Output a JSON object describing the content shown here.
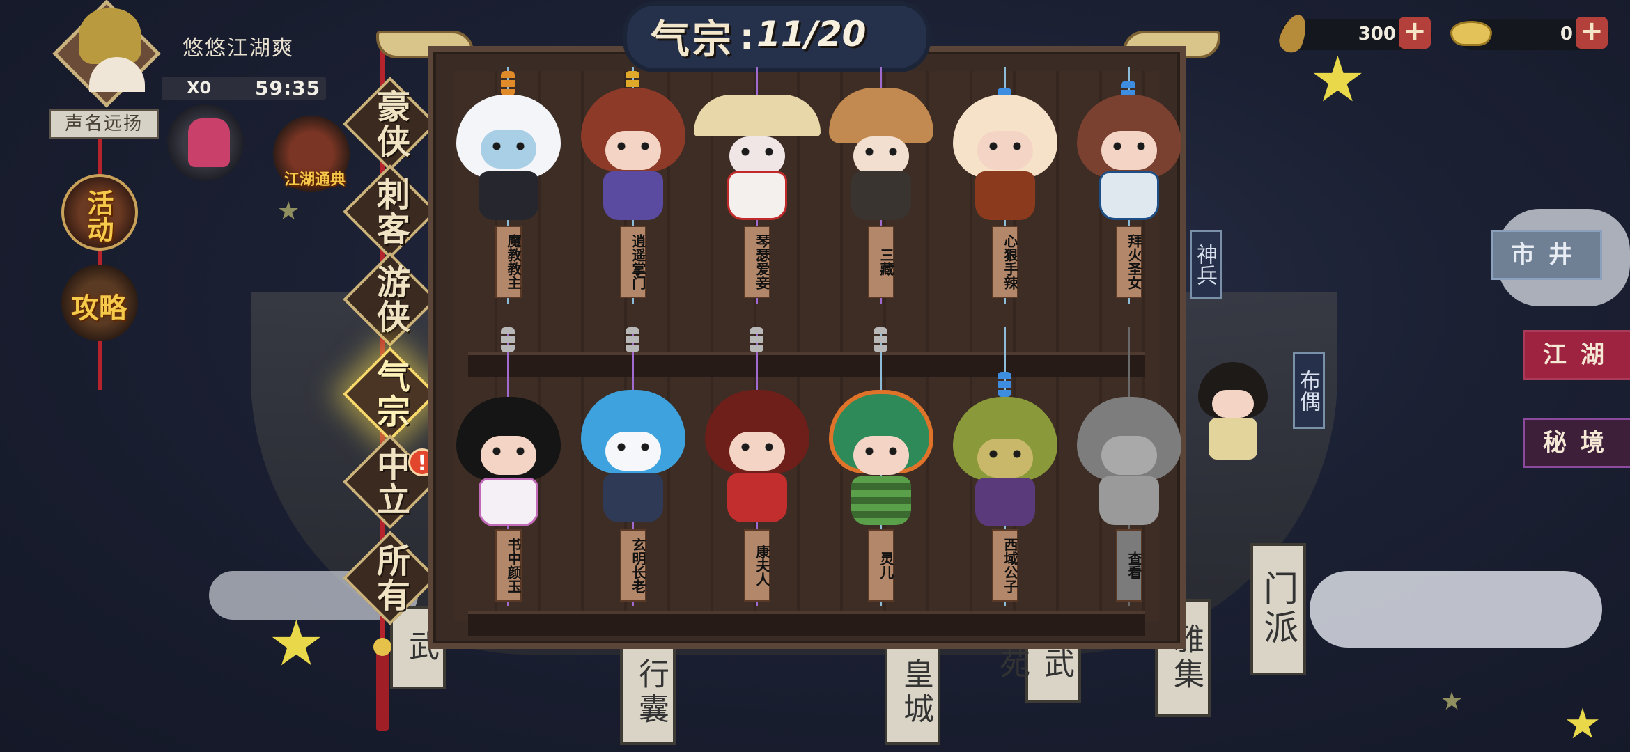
{
  "player": {
    "name": "悠悠江湖爽",
    "multiplier": "X0",
    "timer": "59:35",
    "title_plate": "声名远扬"
  },
  "sidebar": {
    "event_label": "活动",
    "guide_label": "攻略",
    "encyclopedia_label": "江湖通典"
  },
  "resources": [
    {
      "name": "leaf-currency",
      "value": "300"
    },
    {
      "name": "gold-ingot",
      "value": "0"
    }
  ],
  "collection": {
    "category": "气宗",
    "progress": "11/20"
  },
  "tabs": [
    {
      "label": "豪侠",
      "active": false
    },
    {
      "label": "刺客",
      "active": false
    },
    {
      "label": "游侠",
      "active": false
    },
    {
      "label": "气宗",
      "active": true
    },
    {
      "label": "中立",
      "active": false,
      "alert": "!"
    },
    {
      "label": "所有",
      "active": false
    }
  ],
  "figures_row1": [
    {
      "name": "魔教教主",
      "locked": false
    },
    {
      "name": "逍遥掌门",
      "locked": false
    },
    {
      "name": "琴瑟爱妾",
      "locked": false
    },
    {
      "name": "三藏",
      "locked": false
    },
    {
      "name": "心狠手辣",
      "locked": false
    },
    {
      "name": "拜火圣女",
      "locked": false
    }
  ],
  "figures_row2": [
    {
      "name": "书中颜玉",
      "locked": false
    },
    {
      "name": "玄明长老",
      "locked": false
    },
    {
      "name": "康夫人",
      "locked": false
    },
    {
      "name": "灵儿",
      "locked": false
    },
    {
      "name": "西域公子",
      "locked": false
    },
    {
      "name": "查看",
      "locked": true
    }
  ],
  "right_panel": {
    "weapon_tab": "神兵",
    "doll_tab": "布偶",
    "market_btn": "市井",
    "jianghu_btn": "江湖",
    "secret_btn": "秘境",
    "sect_sign": "门派"
  },
  "background_signs": [
    "武",
    "行囊",
    "皇城",
    "武苑",
    "雅集"
  ],
  "colors": {
    "accent_gold": "#f5c94a",
    "alert_red": "#e2462c",
    "board_wood": "#3a2b24",
    "rope_red": "#b5232d"
  }
}
